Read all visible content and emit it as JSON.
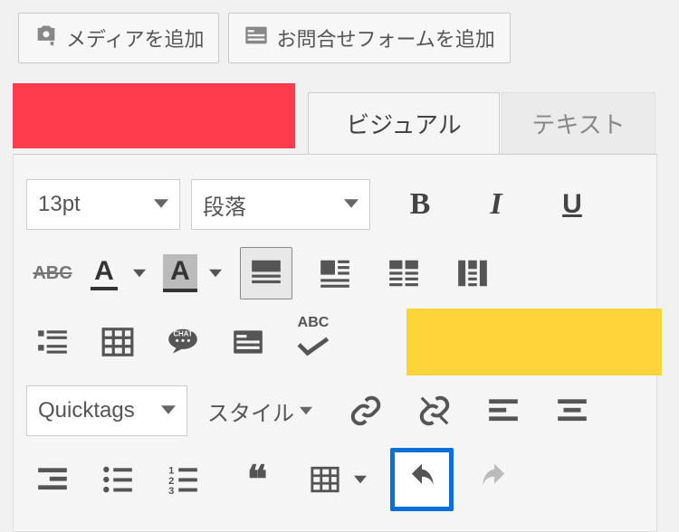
{
  "top_buttons": {
    "add_media": "メディアを追加",
    "add_form": "お問合せフォームを追加"
  },
  "tabs": {
    "visual": "ビジュアル",
    "text": "テキスト"
  },
  "row1": {
    "font_size": "13pt",
    "paragraph": "段落"
  },
  "row3": {
    "abc_check": "ABC"
  },
  "row4": {
    "quicktags": "Quicktags",
    "style": "スタイル"
  }
}
